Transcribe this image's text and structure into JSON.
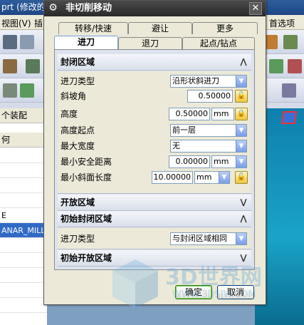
{
  "background": {
    "title": "prt  (修改的",
    "menu": {
      "view": "视图(V)",
      "insert": "插",
      "preferences": "首选项"
    },
    "left_panel": {
      "header1": "个装配",
      "header2": "何",
      "rows": [
        "E",
        "ANAR_MILL"
      ]
    }
  },
  "watermark": {
    "text": "3D世界网",
    "url": "WWW.3DSJW.COM"
  },
  "dialog": {
    "title": "非切削移动",
    "tabs_row1": [
      "转移/快速",
      "避让",
      "更多"
    ],
    "tabs_row2": [
      "进刀",
      "退刀",
      "起点/钻点"
    ],
    "active_tab": "进刀",
    "closed_area": {
      "header": "封闭区域",
      "entry_type_label": "进刀类型",
      "entry_type_value": "沿形状斜进刀",
      "ramp_angle_label": "斜坡角",
      "ramp_angle_value": "0.50000",
      "height_label": "高度",
      "height_value": "0.50000",
      "height_unit": "mm",
      "height_from_label": "高度起点",
      "height_from_value": "前一层",
      "max_width_label": "最大宽度",
      "max_width_value": "无",
      "min_clearance_label": "最小安全距离",
      "min_clearance_value": "0.00000",
      "min_clearance_unit": "mm",
      "min_ramp_len_label": "最小斜面长度",
      "min_ramp_len_value": "10.00000",
      "min_ramp_len_unit": "mm"
    },
    "open_area": {
      "header": "开放区域"
    },
    "initial_closed_area": {
      "header": "初始封闭区域",
      "entry_type_label": "进刀类型",
      "entry_type_value": "与封闭区域相同"
    },
    "initial_open_area": {
      "header": "初始开放区域"
    },
    "ok_label": "确定",
    "cancel_label": "取消"
  }
}
